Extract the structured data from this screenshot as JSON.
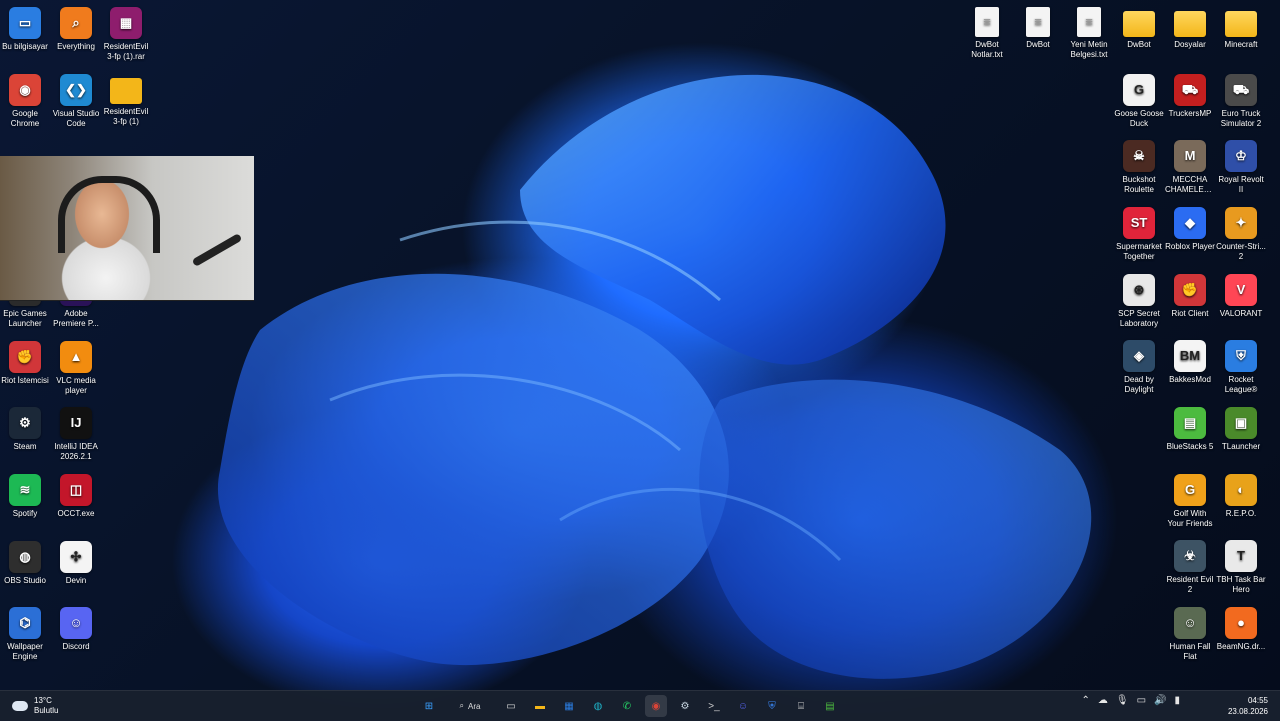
{
  "desktop": {
    "left_icons": [
      {
        "label": "Bu bilgisayar",
        "label2": "",
        "glyph": "▭",
        "color": "#2a7de1",
        "icon": "monitor-icon"
      },
      {
        "label": "Everything",
        "label2": "",
        "glyph": "⌕",
        "color": "#f07b1d",
        "icon": "magnifier-icon"
      },
      {
        "label": "ResidentEvil",
        "label2": "3-fp (1).rar",
        "glyph": "▦",
        "color": "#8e1d6d",
        "icon": "winrar-icon"
      },
      {
        "label": "Google",
        "label2": "Chrome",
        "glyph": "◉",
        "color": "#db4437",
        "icon": "chrome-icon"
      },
      {
        "label": "Visual Studio",
        "label2": "Code",
        "glyph": "❮❯",
        "color": "#1f8ad2",
        "icon": "vscode-icon"
      },
      {
        "label": "ResidentEvil",
        "label2": "3-fp (1)",
        "glyph": "",
        "color": "#f3b619",
        "icon": "folder-icon"
      },
      {
        "label": "Epic Games",
        "label2": "Launcher",
        "glyph": "E",
        "color": "#2b2b2b",
        "icon": "epic-icon"
      },
      {
        "label": "Adobe",
        "label2": "Premiere P...",
        "glyph": "Pr",
        "color": "#2a1258",
        "icon": "premiere-icon"
      },
      {
        "label": "Riot İstemcisi",
        "label2": "",
        "glyph": "✊",
        "color": "#d13639",
        "icon": "riot-icon"
      },
      {
        "label": "VLC media",
        "label2": "player",
        "glyph": "▲",
        "color": "#f28c0f",
        "icon": "vlc-icon"
      },
      {
        "label": "Steam",
        "label2": "",
        "glyph": "⚙",
        "color": "#1b2838",
        "icon": "steam-icon"
      },
      {
        "label": "IntelliJ IDEA",
        "label2": "2026.2.1",
        "glyph": "IJ",
        "color": "#111111",
        "icon": "intellij-icon"
      },
      {
        "label": "Spotify",
        "label2": "",
        "glyph": "≋",
        "color": "#1db954",
        "icon": "spotify-icon"
      },
      {
        "label": "OCCT.exe",
        "label2": "",
        "glyph": "◫",
        "color": "#c3162a",
        "icon": "occt-icon"
      },
      {
        "label": "OBS Studio",
        "label2": "",
        "glyph": "◍",
        "color": "#2e2e2e",
        "icon": "obs-icon"
      },
      {
        "label": "Devin",
        "label2": "",
        "glyph": "✣",
        "color": "#f4f4f4",
        "icon": "devin-icon"
      },
      {
        "label": "Wallpaper",
        "label2": "Engine",
        "glyph": "⌬",
        "color": "#2b6fd6",
        "icon": "wallpaper-engine-icon"
      },
      {
        "label": "Discord",
        "label2": "",
        "glyph": "☺",
        "color": "#5865f2",
        "icon": "discord-icon"
      }
    ],
    "top_icons": [
      {
        "label": "DwBot",
        "label2": "Notlar.txt",
        "type": "file",
        "icon": "text-file-icon"
      },
      {
        "label": "DwBot",
        "label2": "",
        "type": "file",
        "icon": "settings-file-icon"
      },
      {
        "label": "Yeni Metin",
        "label2": "Belgesi.txt",
        "type": "file",
        "icon": "text-file-icon"
      },
      {
        "label": "DwBot",
        "label2": "",
        "type": "folder",
        "icon": "folder-icon"
      },
      {
        "label": "Dosyalar",
        "label2": "",
        "type": "folder",
        "icon": "folder-icon"
      },
      {
        "label": "Minecraft",
        "label2": "",
        "type": "folder",
        "icon": "folder-icon"
      }
    ],
    "right_icons": [
      {
        "label": "Goose Goose",
        "label2": "Duck",
        "glyph": "G",
        "color": "#f2f2f2",
        "icon": "goose-icon"
      },
      {
        "label": "TruckersMP",
        "label2": "",
        "glyph": "⛟",
        "color": "#c41f1f",
        "icon": "truck-icon"
      },
      {
        "label": "Euro Truck",
        "label2": "Simulator 2",
        "glyph": "⛟",
        "color": "#4a4a4a",
        "icon": "truck-icon"
      },
      {
        "label": "Buckshot",
        "label2": "Roulette",
        "glyph": "☠",
        "color": "#4b2a22",
        "icon": "buckshot-icon"
      },
      {
        "label": "MECCHA",
        "label2": "CHAMELEON",
        "glyph": "M",
        "color": "#7a6a5a",
        "icon": "chameleon-icon"
      },
      {
        "label": "Royal Revolt",
        "label2": "II",
        "glyph": "♔",
        "color": "#2f4fa8",
        "icon": "royal-revolt-icon"
      },
      {
        "label": "Supermarket",
        "label2": "Together",
        "glyph": "ST",
        "color": "#e0243a",
        "icon": "supermarket-icon"
      },
      {
        "label": "Roblox Player",
        "label2": "",
        "glyph": "◆",
        "color": "#2b6cf2",
        "icon": "roblox-icon"
      },
      {
        "label": "Counter-Stri...",
        "label2": "2",
        "glyph": "✦",
        "color": "#e89a1f",
        "icon": "counter-strike-icon"
      },
      {
        "label": "SCP Secret",
        "label2": "Laboratory",
        "glyph": "⊛",
        "color": "#e8e8e8",
        "icon": "scp-icon"
      },
      {
        "label": "Riot Client",
        "label2": "",
        "glyph": "✊",
        "color": "#d13639",
        "icon": "riot-icon"
      },
      {
        "label": "VALORANT",
        "label2": "",
        "glyph": "V",
        "color": "#ff4655",
        "icon": "valorant-icon"
      },
      {
        "label": "Dead by",
        "label2": "Daylight",
        "glyph": "◈",
        "color": "#2d4b68",
        "icon": "dbd-icon"
      },
      {
        "label": "BakkesMod",
        "label2": "",
        "glyph": "BM",
        "color": "#f4f4f4",
        "icon": "bakkesmod-icon"
      },
      {
        "label": "Rocket",
        "label2": "League®",
        "glyph": "⛨",
        "color": "#2a7de1",
        "icon": "rocket-league-icon"
      },
      {
        "label": "BlueStacks 5",
        "label2": "",
        "glyph": "▤",
        "color": "#4cbb3f",
        "icon": "bluestacks-icon"
      },
      {
        "label": "TLauncher",
        "label2": "",
        "glyph": "▣",
        "color": "#4a8a2a",
        "icon": "tlauncher-icon"
      },
      {
        "label": "Golf With",
        "label2": "Your Friends",
        "glyph": "G",
        "color": "#f0a11a",
        "icon": "golf-icon"
      },
      {
        "label": "R.E.P.O.",
        "label2": "",
        "glyph": "◐",
        "color": "#e8a21a",
        "icon": "repo-icon"
      },
      {
        "label": "Resident Evil",
        "label2": "2",
        "glyph": "☣",
        "color": "#3d5364",
        "icon": "resident-evil-icon"
      },
      {
        "label": "TBH Task Bar",
        "label2": "Hero",
        "glyph": "T",
        "color": "#e9e9e9",
        "icon": "taskbar-hero-icon"
      },
      {
        "label": "Human Fall",
        "label2": "Flat",
        "glyph": "☺",
        "color": "#5a6a52",
        "icon": "human-fall-flat-icon"
      },
      {
        "label": "BeamNG.dr...",
        "label2": "",
        "glyph": "●",
        "color": "#f26a1f",
        "icon": "beamng-icon"
      }
    ]
  },
  "taskbar": {
    "weather_temp": "13°C",
    "weather_text": "Bulutlu",
    "search_label": "Ara",
    "apps": [
      {
        "icon": "start-icon",
        "glyph": "⊞",
        "color": "#3aa0ff",
        "active": false
      },
      {
        "icon": "search-icon",
        "glyph": "⌕",
        "color": "#ffffff",
        "active": false
      },
      {
        "icon": "task-view-icon",
        "glyph": "▭",
        "color": "#d8d8d8",
        "active": false
      },
      {
        "icon": "file-explorer-icon",
        "glyph": "▬",
        "color": "#f3b619",
        "active": false
      },
      {
        "icon": "store-icon",
        "glyph": "▦",
        "color": "#2b7de1",
        "active": false
      },
      {
        "icon": "edge-icon",
        "glyph": "◍",
        "color": "#1fb4c9",
        "active": false
      },
      {
        "icon": "whatsapp-icon",
        "glyph": "✆",
        "color": "#25d366",
        "active": false
      },
      {
        "icon": "chrome-icon",
        "glyph": "◉",
        "color": "#db4437",
        "active": true
      },
      {
        "icon": "steam-icon",
        "glyph": "⚙",
        "color": "#c6d4df",
        "active": false
      },
      {
        "icon": "terminal-icon",
        "glyph": ">_",
        "color": "#cfcfcf",
        "active": false
      },
      {
        "icon": "discord-icon",
        "glyph": "☺",
        "color": "#5865f2",
        "active": false
      },
      {
        "icon": "vpn-icon",
        "glyph": "⛨",
        "color": "#3a8bff",
        "active": false
      },
      {
        "icon": "network-tool-icon",
        "glyph": "⌸",
        "color": "#cfcfcf",
        "active": false
      },
      {
        "icon": "bluestacks-icon",
        "glyph": "▤",
        "color": "#4cbb3f",
        "active": false
      }
    ],
    "tray_icons": [
      "chevron-up-icon",
      "onedrive-icon",
      "microphone-icon",
      "display-icon",
      "volume-icon",
      "battery-icon"
    ],
    "tray_glyphs": [
      "⌃",
      "☁",
      "🎙",
      "▭",
      "🔊",
      "▮"
    ],
    "time": "04:55",
    "date": "23.08.2026"
  }
}
